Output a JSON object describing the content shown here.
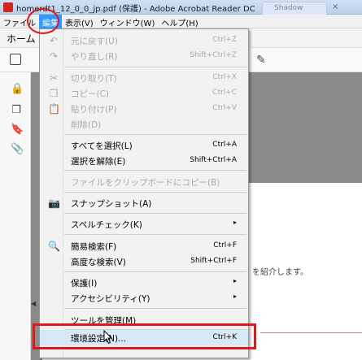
{
  "window": {
    "title": "homerdt1_12_0_0_jp.pdf (保護) - Adobe Acrobat Reader DC",
    "background_tab": "Shadow",
    "tab_close": "×"
  },
  "menubar": {
    "items": [
      "ファイル",
      "編集",
      "表示(V)",
      "ウィンドウ(W)",
      "ヘルプ(H)"
    ],
    "active": "編集"
  },
  "app": {
    "home_tab": "ホーム",
    "page_text": "を紹介します。"
  },
  "dropdown": {
    "items": [
      {
        "label": "元に戻す(U)",
        "shortcut": "Ctrl+Z",
        "disabled": true,
        "icon": "undo-icon"
      },
      {
        "label": "やり直し(R)",
        "shortcut": "Shift+Ctrl+Z",
        "disabled": true,
        "icon": "redo-icon"
      },
      {
        "label": "切り取り(T)",
        "shortcut": "Ctrl+X",
        "disabled": true,
        "icon": "cut-icon"
      },
      {
        "label": "コピー(C)",
        "shortcut": "Ctrl+C",
        "disabled": true,
        "icon": "copy-icon"
      },
      {
        "label": "貼り付け(P)",
        "shortcut": "Ctrl+V",
        "disabled": true,
        "icon": "paste-icon"
      },
      {
        "label": "削除(D)",
        "shortcut": "",
        "disabled": true,
        "icon": ""
      },
      {
        "label": "すべてを選択(L)",
        "shortcut": "Ctrl+A",
        "disabled": false,
        "icon": ""
      },
      {
        "label": "選択を解除(E)",
        "shortcut": "Shift+Ctrl+A",
        "disabled": false,
        "icon": ""
      },
      {
        "label": "ファイルをクリップボードにコピー(B)",
        "shortcut": "",
        "disabled": true,
        "icon": ""
      },
      {
        "label": "スナップショット(A)",
        "shortcut": "",
        "disabled": false,
        "icon": "camera-icon"
      },
      {
        "label": "スペルチェック(K)",
        "shortcut": "",
        "disabled": false,
        "icon": "",
        "submenu": true
      },
      {
        "label": "簡易検索(F)",
        "shortcut": "Ctrl+F",
        "disabled": false,
        "icon": "search-icon"
      },
      {
        "label": "高度な検索(V)",
        "shortcut": "Shift+Ctrl+F",
        "disabled": false,
        "icon": ""
      },
      {
        "label": "保護(I)",
        "shortcut": "",
        "disabled": false,
        "icon": "",
        "submenu": true
      },
      {
        "label": "アクセシビリティ(Y)",
        "shortcut": "",
        "disabled": false,
        "icon": "",
        "submenu": true
      },
      {
        "label": "ツールを管理(M)",
        "shortcut": "",
        "disabled": false,
        "icon": ""
      },
      {
        "label": "環境設定(N)...",
        "shortcut": "Ctrl+K",
        "disabled": false,
        "icon": "",
        "highlighted": true
      }
    ],
    "submenu_arrow": "▸"
  },
  "icons": {
    "undo": "↶",
    "redo": "↷",
    "cut": "✂",
    "copy": "❐",
    "paste": "📋",
    "camera": "📷",
    "search": "🔍",
    "lock": "🔒",
    "pages": "❐",
    "bookmark": "🔖",
    "attach": "📎",
    "sign": "✎",
    "collapse": "◀"
  },
  "colors": {
    "menu_active": "#3399ff",
    "annotation_red": "#e0181b",
    "highlight": "#d9e8f7"
  }
}
